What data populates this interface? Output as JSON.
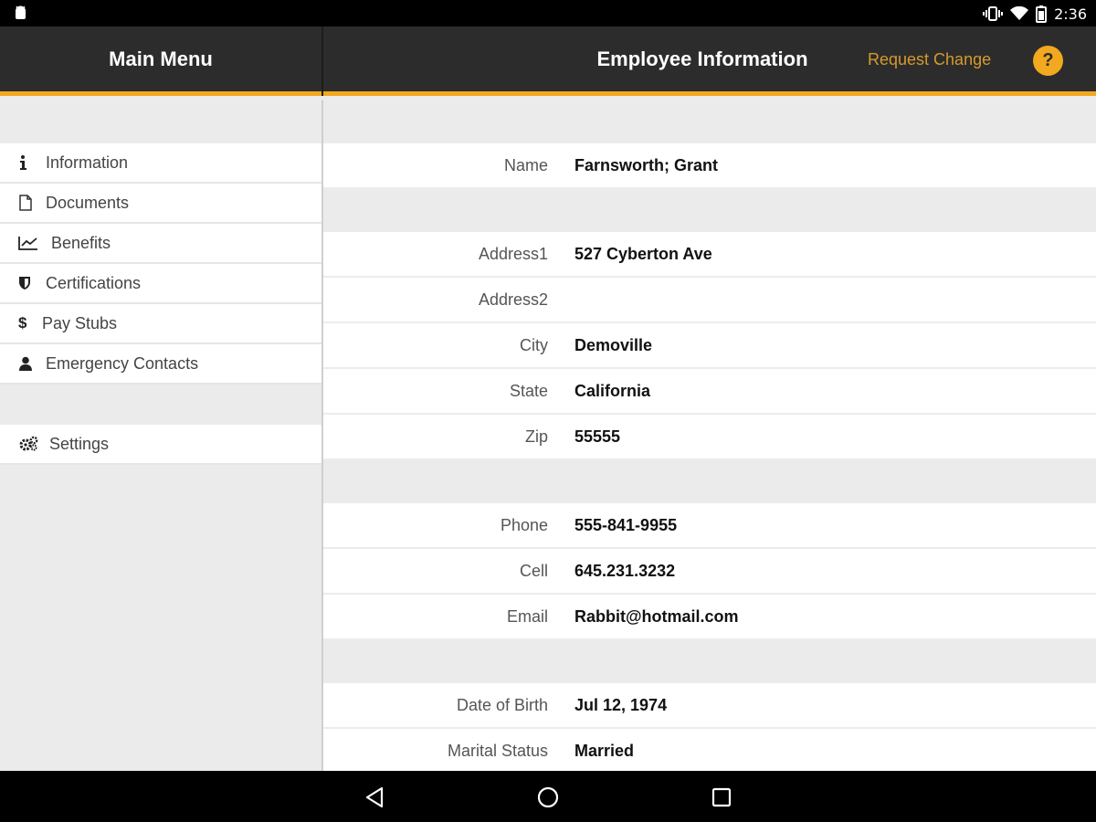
{
  "status_bar": {
    "time": "2:36",
    "icons": [
      "android-icon",
      "vibrate-icon",
      "wifi-icon",
      "battery-icon"
    ]
  },
  "header": {
    "menu_title": "Main Menu",
    "page_title": "Employee Information",
    "request_change_label": "Request Change",
    "help_label": "?",
    "accent_color": "#f2a81f"
  },
  "sidebar": {
    "items": [
      {
        "label": "Information",
        "icon": "info-icon"
      },
      {
        "label": "Documents",
        "icon": "document-icon"
      },
      {
        "label": "Benefits",
        "icon": "chart-line-icon"
      },
      {
        "label": "Certifications",
        "icon": "shield-icon"
      },
      {
        "label": "Pay Stubs",
        "icon": "dollar-icon"
      },
      {
        "label": "Emergency Contacts",
        "icon": "person-icon"
      }
    ],
    "settings": {
      "label": "Settings",
      "icon": "gears-icon"
    }
  },
  "employee": {
    "groups": [
      [
        {
          "label": "Name",
          "value": "Farnsworth; Grant"
        }
      ],
      [
        {
          "label": "Address1",
          "value": "527 Cyberton Ave"
        },
        {
          "label": "Address2",
          "value": ""
        },
        {
          "label": "City",
          "value": "Demoville"
        },
        {
          "label": "State",
          "value": "California"
        },
        {
          "label": "Zip",
          "value": "55555"
        }
      ],
      [
        {
          "label": "Phone",
          "value": "555-841-9955"
        },
        {
          "label": "Cell",
          "value": "645.231.3232"
        },
        {
          "label": "Email",
          "value": "Rabbit@hotmail.com"
        }
      ],
      [
        {
          "label": "Date of Birth",
          "value": "Jul 12, 1974"
        },
        {
          "label": "Marital Status",
          "value": "Married"
        }
      ]
    ]
  },
  "nav_bar": {
    "buttons": [
      "back-icon",
      "home-icon",
      "recents-icon"
    ]
  }
}
